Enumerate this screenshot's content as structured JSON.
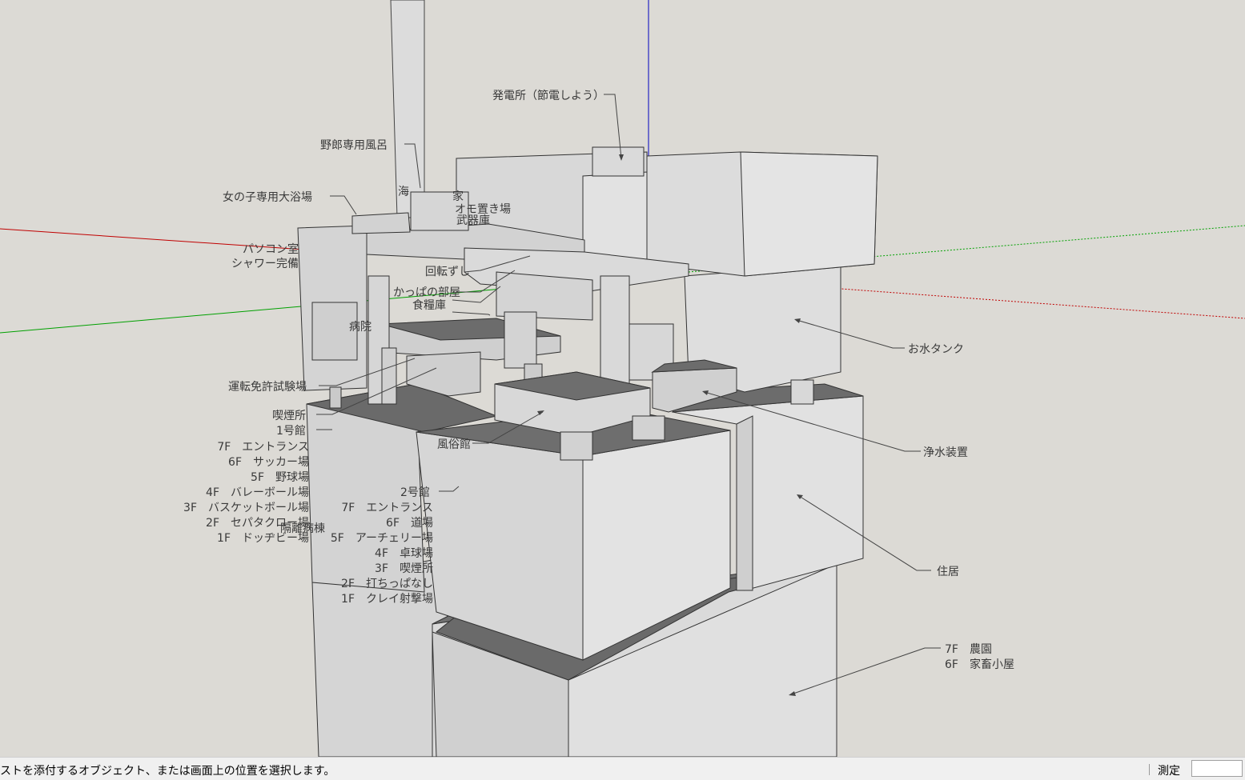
{
  "viewport": {
    "labels": {
      "power_plant": "発電所（節電しよう）",
      "mens_bath": "野郎専用風呂",
      "girls_bath": "女の子専用大浴場",
      "sea": "海",
      "house_partial": "家",
      "storage": "オモ置き場",
      "armory": "武器庫",
      "pc_room": "パソコン室",
      "shower": "シャワー完備",
      "sushi": "回転ずし",
      "kappa_room": "かっぱの部屋",
      "food_storage": "食糧庫",
      "hospital": "病院",
      "driving_test": "運転免許試験場",
      "smoking": "喫煙所",
      "building1": "1号館",
      "b1_7f": "7F　エントランス",
      "b1_6f": "6F　サッカー場",
      "b1_5f": "5F　野球場",
      "b1_4f": "4F　バレーボール場",
      "b1_3f": "3F　バスケットボール場",
      "b1_2f": "2F　セパタクロー場",
      "b1_1f": "1F　ドッヂビー場",
      "isolation_ward": "隔離病棟",
      "fuuzoku": "風俗館",
      "building2": "2号館",
      "b2_7f": "7F　エントランス",
      "b2_6f": "6F　道場",
      "b2_5f": "5F　アーチェリー場",
      "b2_4f": "4F　卓球場",
      "b2_3f": "3F　喫煙所",
      "b2_2f": "2F　打ちっぱなし",
      "b2_1f": "1F　クレイ射撃場",
      "water_tank": "お水タンク",
      "purifier": "浄水装置",
      "residence": "住居",
      "farm_7f": "7F　農園",
      "barn_6f": "6F　家畜小屋"
    }
  },
  "status": {
    "message": "ストを添付するオブジェクト、または画面上の位置を選択します。",
    "measure_label": "測定",
    "measure_value": ""
  },
  "colors": {
    "background": "#dcdad5",
    "box_face_light": "#e6e6e6",
    "box_face_mid": "#d2d2d2",
    "box_top_dark": "#6e6e6e",
    "axis_red": "#c00000",
    "axis_green": "#00a000",
    "axis_blue": "#0000c0"
  }
}
